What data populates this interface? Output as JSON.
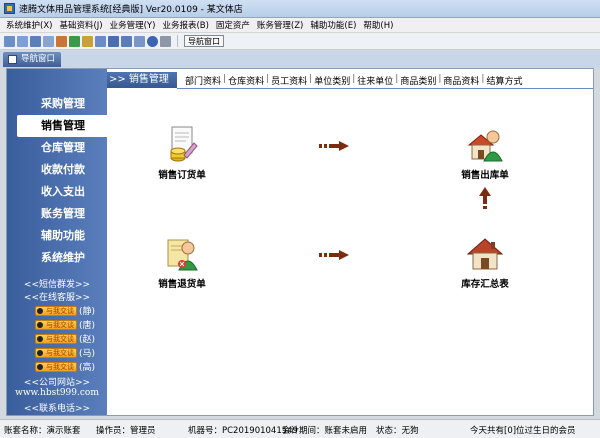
{
  "window": {
    "title": "速腾文体用品管理系统[经典版] Ver20.0109 - 某文体店"
  },
  "menu": [
    "系统维护(X)",
    "基础资料(J)",
    "业务管理(Y)",
    "业务报表(B)",
    "固定资产",
    "账务管理(Z)",
    "辅助功能(E)",
    "帮助(H)"
  ],
  "toolbar": {
    "nav_button": "导航窗口"
  },
  "dock": {
    "tab_label": "导航窗口"
  },
  "sidebar": {
    "items": [
      "采购管理",
      "销售管理",
      "仓库管理",
      "收款付款",
      "收入支出",
      "账务管理",
      "辅助功能",
      "系统维护"
    ],
    "active": "销售管理",
    "sms": "<<短信群发>>",
    "support": "<<在线客服>>",
    "qq_badge": "与我交谈",
    "qq_contacts": [
      "(静)",
      "(唐)",
      "(赵)",
      "(马)",
      "(高)"
    ],
    "site_label": "<<公司网站>>",
    "site_url": "www.hbst999.com",
    "phone": "<<联系电话>>"
  },
  "content": {
    "crumb": ">> 销售管理",
    "tabs": [
      "部门资料",
      "仓库资料",
      "员工资料",
      "单位类别",
      "往来单位",
      "商品类别",
      "商品资料",
      "结算方式"
    ],
    "nodes": {
      "sales_order": "销售订货单",
      "sales_outbound": "销售出库单",
      "sales_return": "销售退货单",
      "inventory_summary": "库存汇总表"
    }
  },
  "status": {
    "account": "账套名称：演示账套",
    "operator": "操作员：管理员",
    "machine": "机器号：PC201901041549",
    "period": "会计期间：账套未启用",
    "state": "状态：无狗",
    "birthday": "今天共有[0]位过生日的会员"
  },
  "colors": {
    "sidebar": "#4a6fae",
    "arrow": "#7a2b10",
    "accent": "#3a5e9c"
  }
}
